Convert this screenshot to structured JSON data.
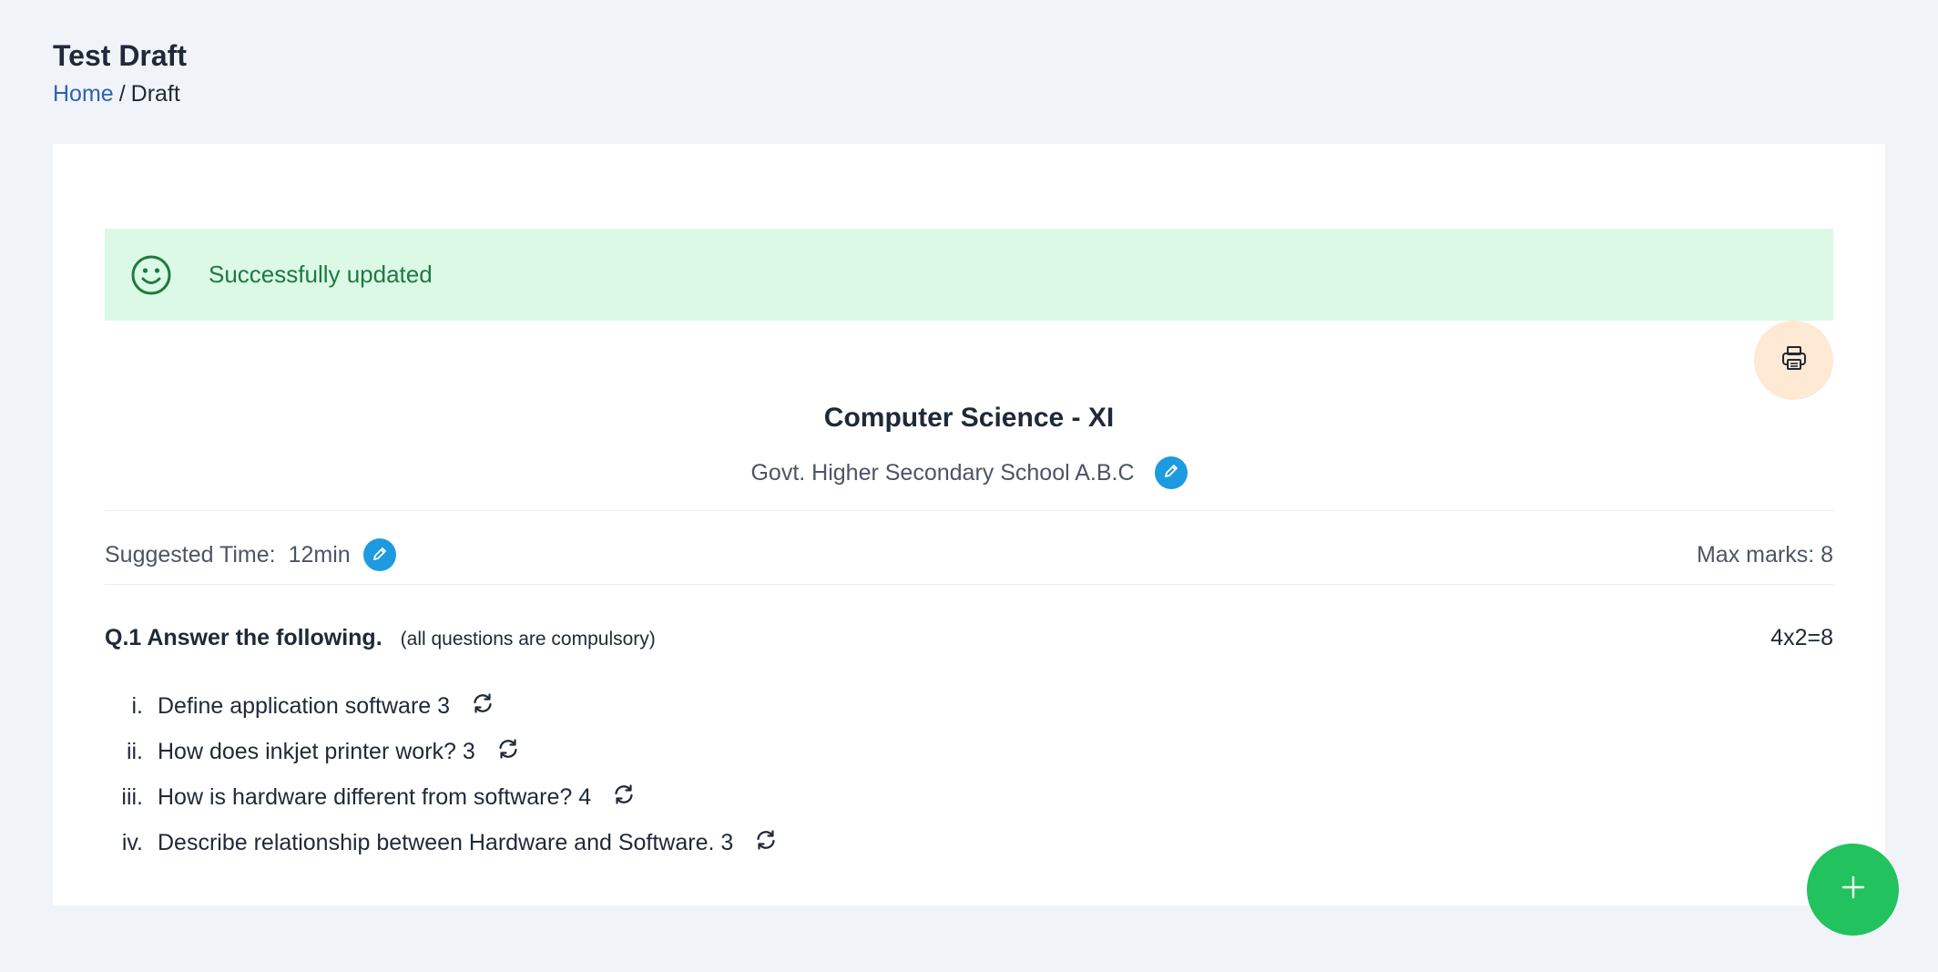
{
  "header": {
    "title": "Test Draft",
    "breadcrumb": {
      "home": "Home",
      "separator": "/",
      "current": "Draft"
    }
  },
  "alert": {
    "icon": "smile-icon",
    "message": "Successfully updated"
  },
  "toolbar": {
    "print_icon": "printer-icon"
  },
  "paper": {
    "title": "Computer Science - XI",
    "school": "Govt. Higher Secondary School A.B.C",
    "suggested_time_label": "Suggested Time:",
    "suggested_time_value": "12min",
    "max_marks": "Max marks: 8"
  },
  "question": {
    "title": "Q.1 Answer the following.",
    "note": "(all questions are compulsory)",
    "marks": "4x2=8",
    "items": [
      {
        "num": "i.",
        "text": "Define application software 3"
      },
      {
        "num": "ii.",
        "text": "How does inkjet printer work? 3"
      },
      {
        "num": "iii.",
        "text": "How is hardware different from software? 4"
      },
      {
        "num": "iv.",
        "text": "Describe relationship between Hardware and Software. 3"
      }
    ]
  },
  "colors": {
    "accent_blue": "#1e9ae0",
    "success_bg": "#dcf9e6",
    "success_text": "#1d7a41",
    "fab_green": "#22c35e",
    "print_bg": "#fde9d4"
  }
}
